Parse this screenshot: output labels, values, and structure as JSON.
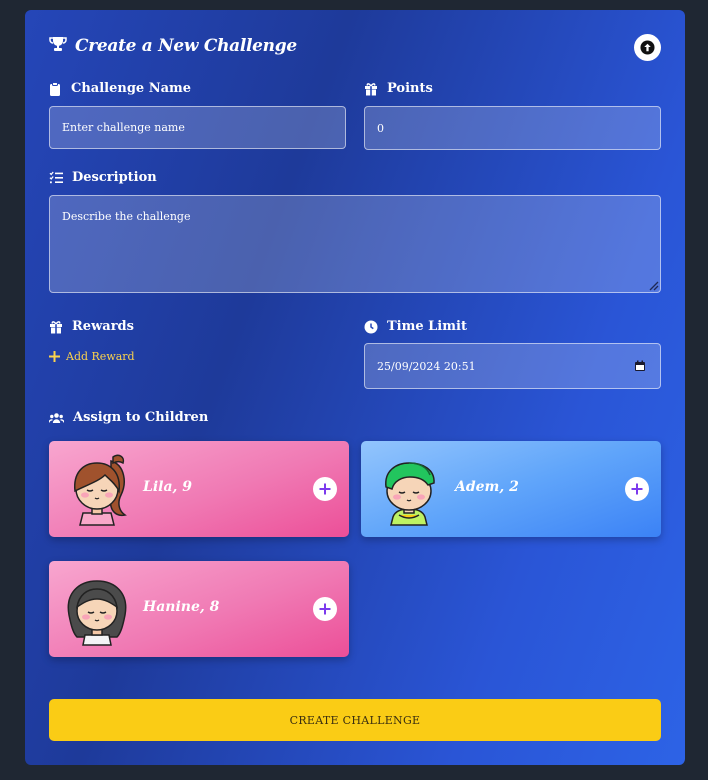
{
  "header": {
    "title": "Create a New Challenge",
    "trophy_icon": "trophy-icon",
    "collapse_icon": "arrow-up-circle-icon"
  },
  "form": {
    "challenge_name": {
      "label": "Challenge Name",
      "placeholder": "Enter challenge name",
      "value": ""
    },
    "points": {
      "label": "Points",
      "value": "0"
    },
    "description": {
      "label": "Description",
      "placeholder": "Describe the challenge",
      "value": ""
    },
    "rewards": {
      "label": "Rewards",
      "add_label": "Add Reward"
    },
    "time_limit": {
      "label": "Time Limit",
      "value": "25/09/2024 20:51"
    },
    "assign": {
      "label": "Assign to Children"
    }
  },
  "children": [
    {
      "name": "Lila, 9",
      "theme": "pink"
    },
    {
      "name": "Adem, 2",
      "theme": "blue"
    },
    {
      "name": "Hanine, 8",
      "theme": "pink"
    }
  ],
  "submit_label": "CREATE CHALLENGE",
  "colors": {
    "accent_yellow": "#facc15",
    "add_reward_text": "#fcd34d",
    "card_blue": "#2546b8",
    "child_pink": "#ec4f98",
    "child_blue": "#3b82f6"
  }
}
